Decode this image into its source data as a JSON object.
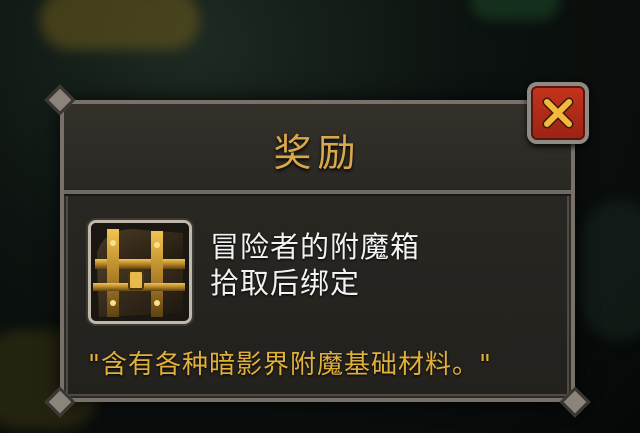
{
  "dialog": {
    "title": "奖励",
    "item": {
      "name": "冒险者的附魔箱",
      "binding": "拾取后绑定",
      "icon": "treasure-chest-icon"
    },
    "flavor_text": "\"含有各种暗影界附魔基础材料。\"",
    "close_icon": "close-icon"
  },
  "colors": {
    "title_gold": "#d9a84a",
    "flavor_gold": "#e0b03c",
    "close_red": "#c4341d",
    "panel_border": "#77716a"
  }
}
